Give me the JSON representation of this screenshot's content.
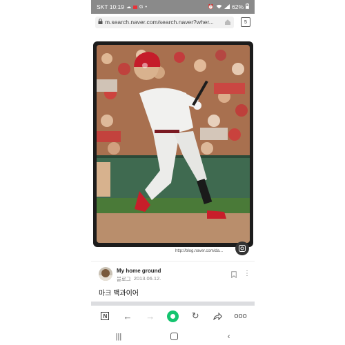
{
  "status_bar": {
    "carrier_time": "SKT 10:19",
    "battery": "62%",
    "icons_left": [
      "cloud-icon",
      "red-box-icon",
      "g-icon",
      "dot-icon"
    ],
    "icons_right": [
      "alarm-icon",
      "wifi-icon",
      "signal-icon",
      "battery-icon"
    ]
  },
  "browser": {
    "url": "m.search.naver.com/search.naver?wher...",
    "tab_count": "5"
  },
  "photo": {
    "watermark": "http://blog.naver.com/da..."
  },
  "blog": {
    "name": "My home ground",
    "source": "블로그",
    "date": "2013.06.12.",
    "title": "마크 맥과이어"
  },
  "nav": {
    "naver_label": "N",
    "more_label": "ooo"
  },
  "colors": {
    "accent_green": "#14c46f",
    "status_bar": "#8a8a8a"
  }
}
